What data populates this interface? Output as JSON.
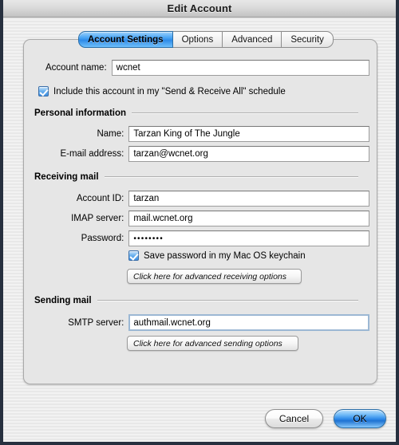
{
  "window": {
    "title": "Edit Account"
  },
  "tabs": [
    {
      "label": "Account Settings",
      "active": true
    },
    {
      "label": "Options",
      "active": false
    },
    {
      "label": "Advanced",
      "active": false
    },
    {
      "label": "Security",
      "active": false
    }
  ],
  "account_name": {
    "label": "Account name:",
    "value": "wcnet"
  },
  "include_checkbox": {
    "label": "Include this account in my \"Send & Receive All\" schedule",
    "checked": true
  },
  "personal_information": {
    "title": "Personal information",
    "name": {
      "label": "Name:",
      "value": "Tarzan King of The Jungle"
    },
    "email": {
      "label": "E-mail address:",
      "value": "tarzan@wcnet.org"
    }
  },
  "receiving_mail": {
    "title": "Receiving mail",
    "account_id": {
      "label": "Account ID:",
      "value": "tarzan"
    },
    "imap_server": {
      "label": "IMAP server:",
      "value": "mail.wcnet.org"
    },
    "password": {
      "label": "Password:",
      "value": "••••••••"
    },
    "keychain_checkbox": {
      "label": "Save password in my Mac OS keychain",
      "checked": true
    },
    "advanced_button": "Click here for advanced receiving options"
  },
  "sending_mail": {
    "title": "Sending mail",
    "smtp_server": {
      "label": "SMTP server:",
      "value": "authmail.wcnet.org",
      "focused": true
    },
    "advanced_button": "Click here for advanced sending options"
  },
  "footer": {
    "cancel": "Cancel",
    "ok": "OK"
  },
  "colors": {
    "accent_blue": "#2f8ae9",
    "panel_bg": "#e6e6e6",
    "window_border": "#27303f"
  }
}
